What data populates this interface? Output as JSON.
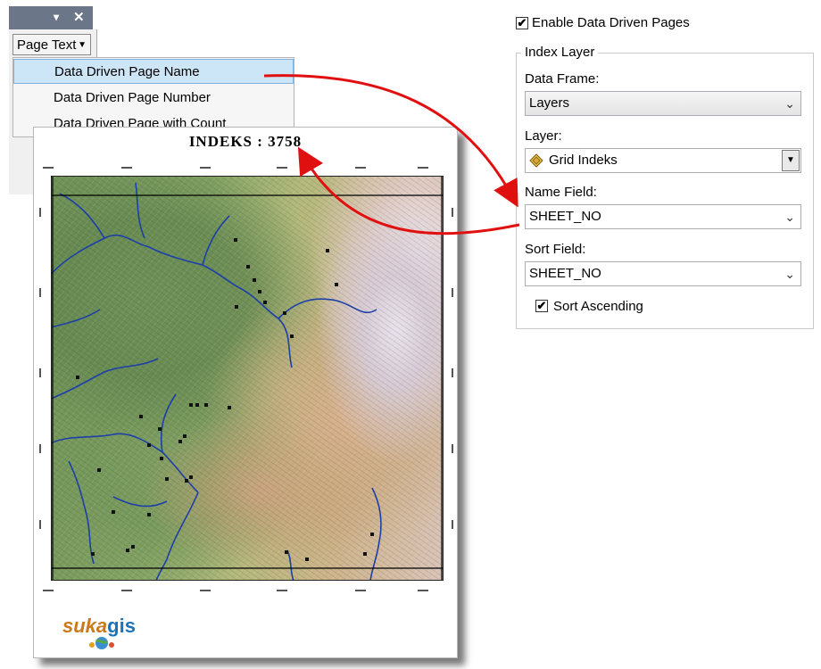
{
  "toolbar": {
    "close_glyph": "✕",
    "dropdown_glyph": "▾",
    "page_text_button": "Page Text",
    "menu_items": [
      {
        "label": "Data Driven Page Name",
        "selected": true
      },
      {
        "label": "Data Driven Page Number",
        "selected": false
      },
      {
        "label": "Data Driven Page with Count",
        "selected": false
      }
    ]
  },
  "map_page": {
    "title": "INDEKS : 3758",
    "logo_part1": "suka",
    "logo_part2": "gis"
  },
  "settings": {
    "enable_checkbox_label": "Enable Data Driven Pages",
    "enable_checked": true,
    "group_title": "Index Layer",
    "data_frame": {
      "label": "Data Frame:",
      "value": "Layers"
    },
    "layer": {
      "label": "Layer:",
      "value": "Grid Indeks"
    },
    "name_field": {
      "label": "Name Field:",
      "value": "SHEET_NO"
    },
    "sort_field": {
      "label": "Sort Field:",
      "value": "SHEET_NO"
    },
    "sort_ascending_label": "Sort Ascending",
    "sort_ascending_checked": true
  },
  "colors": {
    "annotation_arrow": "#e11010",
    "menu_highlight": "#cde6f7",
    "river": "#1c3fa8"
  }
}
